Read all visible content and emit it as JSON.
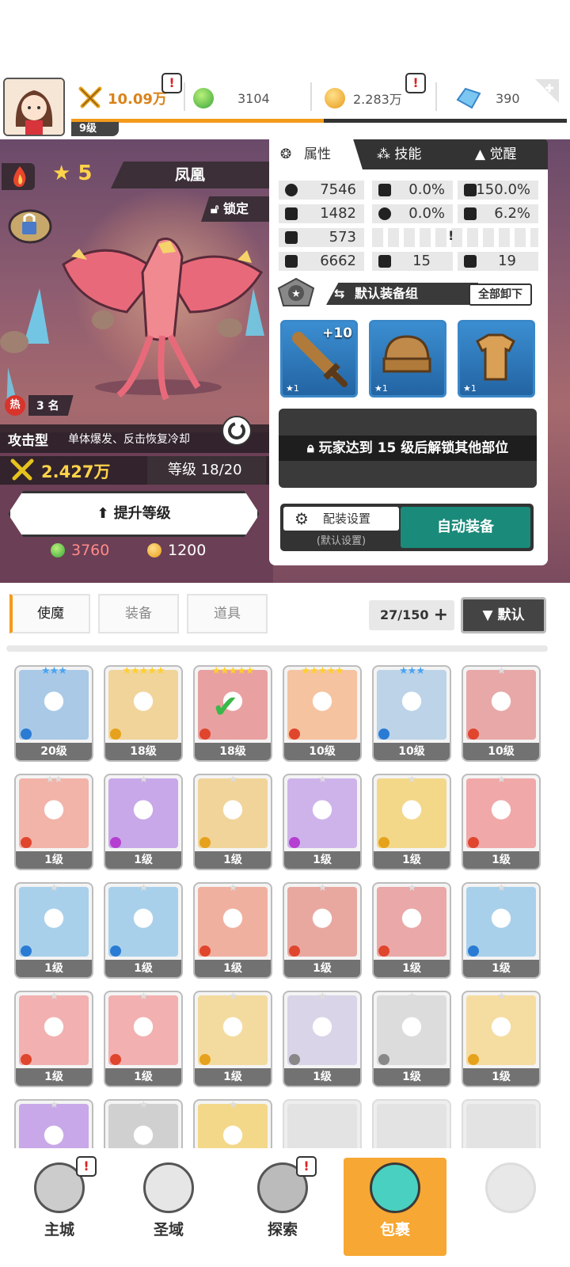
{
  "topbar": {
    "level": "9级",
    "xp_progress": 0.51,
    "power": "10.09万",
    "gems": "3104",
    "gold": "2.283万",
    "crystals": "390",
    "alert_mark": "!"
  },
  "hero": {
    "stars": "5",
    "name": "凤凰",
    "lock_label": "锁定",
    "hot_icon": "热",
    "hot_rank": "3 名",
    "type": "攻击型",
    "type_desc": "单体爆发、反击恢复冷却",
    "power": "2.427万",
    "level_text": "等级 18/20",
    "upgrade_label": "提升等级",
    "cost_gems": "3760",
    "cost_gold": "1200"
  },
  "card": {
    "tabs": [
      "属性",
      "技能",
      "觉醒"
    ],
    "stats": {
      "hp": "7546",
      "crit": "0.0%",
      "crit_dmg": "150.0%",
      "atk": "1482",
      "hit": "0.0%",
      "speed": "6.2%",
      "def": "573",
      "power": "6662",
      "stat_a": "15",
      "stat_b": "19"
    },
    "stripe_mark": "!",
    "set_label": "默认装备组",
    "unequip_label": "全部卸下",
    "slots": [
      {
        "plus": "+10",
        "stars": "★1"
      },
      {
        "plus": "",
        "stars": "★1"
      },
      {
        "plus": "",
        "stars": "★1"
      }
    ],
    "locked_msg": "玩家达到 15 级后解锁其他部位",
    "config_label": "配装设置",
    "config_sub": "(默认设置)",
    "auto_label": "自动装备"
  },
  "inventory": {
    "tabs": [
      "使魔",
      "装备",
      "道具"
    ],
    "count": "27/150",
    "sort_label": "▼ 默认",
    "items": [
      {
        "stars": "★★★",
        "level": "20级",
        "color": "#a9c9e6",
        "elem": "#2a7bd3",
        "star_color": "#4aa3f0"
      },
      {
        "stars": "★★★★★",
        "level": "18级",
        "color": "#f0d49a",
        "elem": "#e6a21c",
        "star_color": "#ffcf2e"
      },
      {
        "stars": "★★★★★",
        "level": "18级",
        "color": "#e9a0a0",
        "elem": "#e0452d",
        "star_color": "#ffcf2e",
        "selected": true
      },
      {
        "stars": "★★★★★",
        "level": "10级",
        "color": "#f5c3a0",
        "elem": "#e0452d",
        "star_color": "#ffcf2e"
      },
      {
        "stars": "★★★",
        "level": "10级",
        "color": "#bcd3e8",
        "elem": "#2a7bd3",
        "star_color": "#4aa3f0"
      },
      {
        "stars": "★",
        "level": "10级",
        "color": "#e8a8a8",
        "elem": "#e0452d",
        "star_color": "#ddd"
      },
      {
        "stars": "★★",
        "level": "1级",
        "color": "#f2b3a8",
        "elem": "#e0452d",
        "star_color": "#ddd"
      },
      {
        "stars": "★",
        "level": "1级",
        "color": "#c8a8e8",
        "elem": "#b43fd0",
        "star_color": "#ddd"
      },
      {
        "stars": "★",
        "level": "1级",
        "color": "#f0d49a",
        "elem": "#e6a21c",
        "star_color": "#ddd"
      },
      {
        "stars": "★",
        "level": "1级",
        "color": "#cdb3ea",
        "elem": "#b43fd0",
        "star_color": "#ddd"
      },
      {
        "stars": "★",
        "level": "1级",
        "color": "#f3d88a",
        "elem": "#e6a21c",
        "star_color": "#ddd"
      },
      {
        "stars": "★",
        "level": "1级",
        "color": "#f0a8a8",
        "elem": "#e0452d",
        "star_color": "#ddd"
      },
      {
        "stars": "★",
        "level": "1级",
        "color": "#a9d0ea",
        "elem": "#2a7bd3",
        "star_color": "#ddd"
      },
      {
        "stars": "★",
        "level": "1级",
        "color": "#a9d0ea",
        "elem": "#2a7bd3",
        "star_color": "#ddd"
      },
      {
        "stars": "★",
        "level": "1级",
        "color": "#f0b0a0",
        "elem": "#e0452d",
        "star_color": "#ddd"
      },
      {
        "stars": "★",
        "level": "1级",
        "color": "#e8a8a0",
        "elem": "#e0452d",
        "star_color": "#ddd"
      },
      {
        "stars": "★",
        "level": "1级",
        "color": "#eaa8a8",
        "elem": "#e0452d",
        "star_color": "#ddd"
      },
      {
        "stars": "★",
        "level": "1级",
        "color": "#a9d0ea",
        "elem": "#2a7bd3",
        "star_color": "#ddd"
      },
      {
        "stars": "★",
        "level": "1级",
        "color": "#f2b0b0",
        "elem": "#e0452d",
        "star_color": "#ddd"
      },
      {
        "stars": "★",
        "level": "1级",
        "color": "#f2b0b0",
        "elem": "#e0452d",
        "star_color": "#ddd"
      },
      {
        "stars": "★",
        "level": "1级",
        "color": "#f3dba0",
        "elem": "#e6a21c",
        "star_color": "#ddd"
      },
      {
        "stars": "★",
        "level": "1级",
        "color": "#d9d4e8",
        "elem": "#888888",
        "star_color": "#ddd"
      },
      {
        "stars": "★",
        "level": "1级",
        "color": "#dcdcdc",
        "elem": "#888888",
        "star_color": "#ddd"
      },
      {
        "stars": "★",
        "level": "1级",
        "color": "#f5dca0",
        "elem": "#e6a21c",
        "star_color": "#ddd"
      },
      {
        "stars": "★",
        "level": "",
        "color": "#c8a8e8",
        "elem": "",
        "star_color": "#ddd"
      },
      {
        "stars": "★",
        "level": "",
        "color": "#d0d0d0",
        "elem": "",
        "star_color": "#ddd"
      },
      {
        "stars": "★",
        "level": "",
        "color": "#f3d88a",
        "elem": "",
        "star_color": "#ddd"
      },
      {
        "empty": true
      },
      {
        "empty": true
      },
      {
        "empty": true
      }
    ]
  },
  "nav": {
    "items": [
      "主城",
      "圣域",
      "探索",
      "包裹"
    ],
    "active": 3
  }
}
